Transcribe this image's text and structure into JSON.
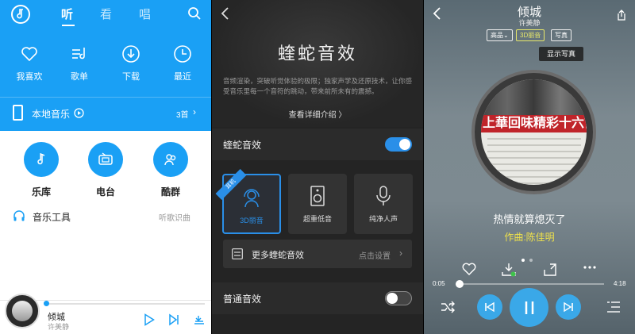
{
  "home": {
    "tabs": [
      "听",
      "看",
      "唱"
    ],
    "quick": [
      {
        "label": "我喜欢",
        "icon": "heart-icon"
      },
      {
        "label": "歌单",
        "icon": "playlist-icon"
      },
      {
        "label": "下载",
        "icon": "download-icon"
      },
      {
        "label": "最近",
        "icon": "clock-icon"
      }
    ],
    "local": {
      "label": "本地音乐",
      "count": "3首"
    },
    "categories": [
      {
        "label": "乐库",
        "icon": "music-note-icon"
      },
      {
        "label": "电台",
        "icon": "radio-icon"
      },
      {
        "label": "酷群",
        "icon": "group-icon"
      }
    ],
    "tools": {
      "label": "音乐工具",
      "right": "听歌识曲"
    },
    "player": {
      "song": "倾城",
      "artist": "许美静"
    }
  },
  "effects": {
    "title": "蝰蛇音效",
    "description": "音频渲染，突破听觉体验的极限；独家声学及还原技术，让你感受音乐里每一个音符的跳动，带来前所未有的震撼。",
    "detail_link": "查看详细介绍 〉",
    "viper_label": "蝰蛇音效",
    "viper_on": true,
    "cards": [
      {
        "label": "3D丽音",
        "selected": true,
        "ribbon": "耳机",
        "icon": "headphone-person-icon"
      },
      {
        "label": "超重低音",
        "selected": false,
        "icon": "speaker-icon"
      },
      {
        "label": "纯净人声",
        "selected": false,
        "icon": "microphone-icon"
      }
    ],
    "more": {
      "label": "更多蝰蛇音效",
      "right": "点击设置"
    },
    "normal_label": "普通音效",
    "normal_on": false
  },
  "nowplaying": {
    "song": "倾城",
    "artist": "许美静",
    "pills": [
      "高品",
      "3D丽音",
      "写真"
    ],
    "tooltip": "显示写真",
    "cover_text": "上華回味精彩十六首",
    "lyric": "热情就算熄灭了",
    "lyric2": "作曲:陈佳明",
    "time_current": "0:05",
    "time_total": "4:18",
    "progress": 0.02
  },
  "colors": {
    "accent": "#1aa0f5",
    "dark": "#242424",
    "highlight": "#f0e24a"
  }
}
